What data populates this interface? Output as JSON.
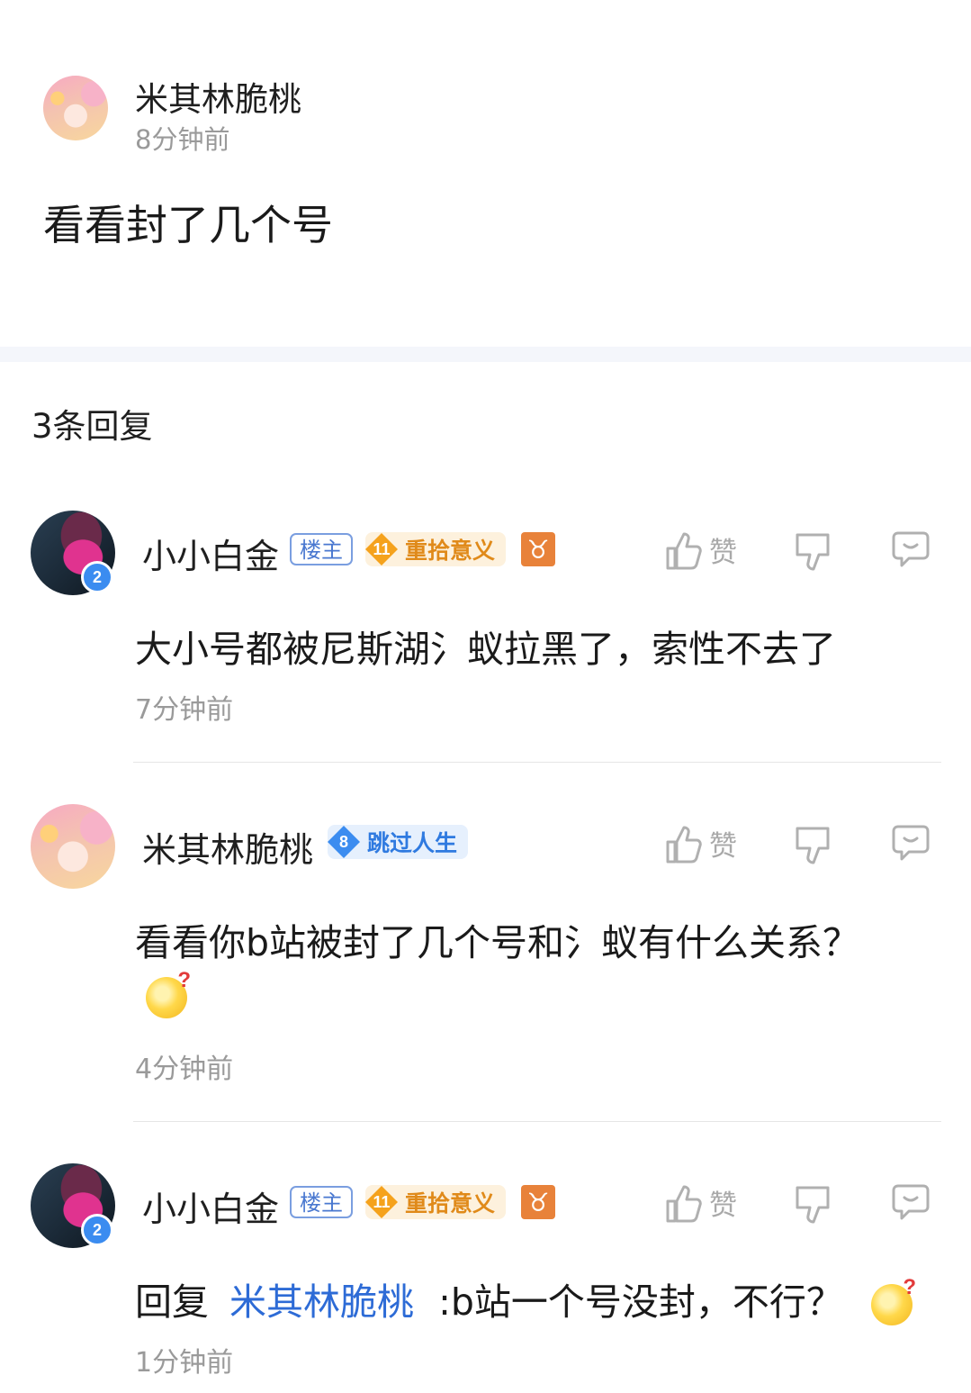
{
  "post": {
    "author": "米其林脆桃",
    "time": "8分钟前",
    "body": "看看封了几个号"
  },
  "reply_count": "3条回复",
  "actions": {
    "like_label": "赞"
  },
  "comments": [
    {
      "author": "小小白金",
      "avatar_badge": "2",
      "host_tag": "楼主",
      "level": "11",
      "level_title": "重拾意义",
      "zodiac": "♉",
      "body": "大小号都被尼斯湖氵蚁拉黑了，索性不去了",
      "time": "7分钟前"
    },
    {
      "author": "米其林脆桃",
      "level": "8",
      "level_title": "跳过人生",
      "body": "看看你b站被封了几个号和氵蚁有什么关系？",
      "emoji": "疑问",
      "time": "4分钟前"
    },
    {
      "author": "小小白金",
      "avatar_badge": "2",
      "host_tag": "楼主",
      "level": "11",
      "level_title": "重拾意义",
      "zodiac": "♉",
      "reply_prefix": "回复",
      "mention": "米其林脆桃",
      "body": ":b站一个号没封，不行？",
      "emoji": "疑问",
      "time": "1分钟前"
    }
  ],
  "colors": {
    "accent_blue": "#2d6bd6",
    "level_gold": "#f5a21c",
    "level_blue": "#3b8cf0",
    "zodiac_orange": "#e8823a"
  }
}
